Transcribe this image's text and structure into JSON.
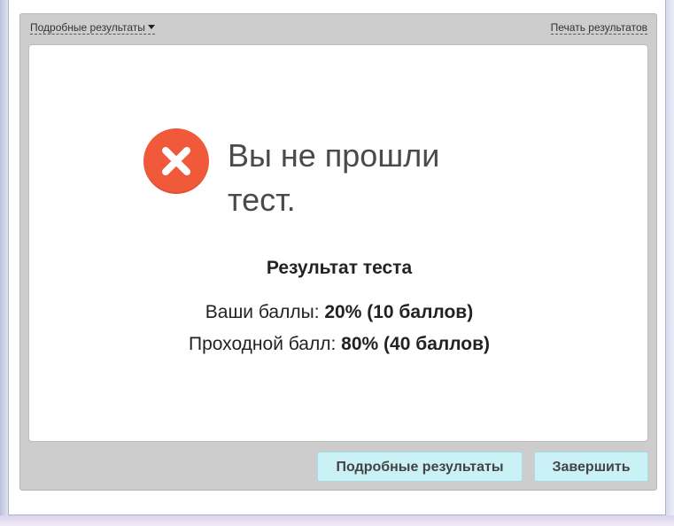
{
  "topbar": {
    "details_dropdown_label": "Подробные результаты",
    "print_label": "Печать результатов"
  },
  "result": {
    "headline": "Вы не прошли тест.",
    "title": "Результат теста",
    "your_score_label": "Ваши баллы:",
    "your_score_value": "20% (10 баллов)",
    "passing_score_label": "Проходной балл:",
    "passing_score_value": "80% (40 баллов)"
  },
  "buttons": {
    "details_label": "Подробные результаты",
    "finish_label": "Завершить"
  },
  "colors": {
    "fail_icon": "#f0593a",
    "button_bg": "#c9f1f6",
    "panel_bg": "#cdcdcd"
  },
  "icons": {
    "status": "close-circle-icon",
    "dropdown": "caret-down-icon"
  }
}
